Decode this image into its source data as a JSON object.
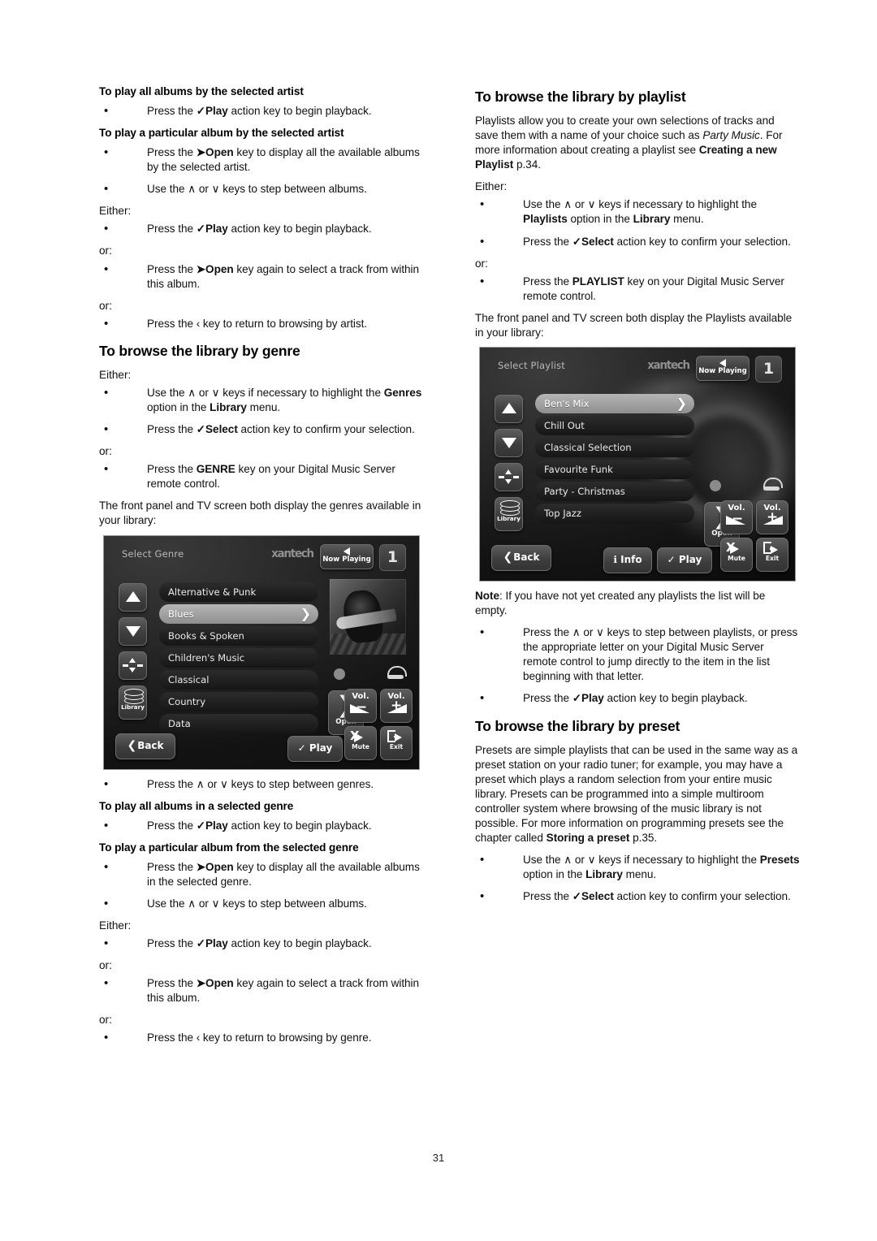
{
  "page": {
    "number": "31"
  },
  "left_column": {
    "blocks": [
      {
        "type": "sub",
        "text": "To play all albums by the selected artist"
      },
      {
        "type": "bullet",
        "html": "Press the <b>✓Play</b> action key to begin playback."
      },
      {
        "type": "sub",
        "text": "To play a particular album by the selected artist"
      },
      {
        "type": "bullet",
        "html": "Press the <b>➤Open</b> key to display all the available albums by the selected artist."
      },
      {
        "type": "bullet",
        "html": "Use the ∧ or ∨ keys to step between albums."
      },
      {
        "type": "lead",
        "text": "Either:"
      },
      {
        "type": "bullet",
        "html": "Press the <b>✓Play</b> action key to begin playback."
      },
      {
        "type": "lead",
        "text": "or:"
      },
      {
        "type": "bullet",
        "html": "Press the <b>➤Open</b> key again to select a track from within this album."
      },
      {
        "type": "lead",
        "text": "or:"
      },
      {
        "type": "bullet",
        "html": "Press the ‹ key to return to browsing by artist."
      },
      {
        "type": "sec",
        "text": "To browse the library by genre"
      },
      {
        "type": "lead",
        "text": "Either:"
      },
      {
        "type": "bullet",
        "html": "Use the ∧ or ∨ keys if necessary to highlight the <b>Genres</b> option in the <b>Library</b> menu."
      },
      {
        "type": "bullet",
        "html": "Press the <b>✓Select</b> action key to confirm your selection."
      },
      {
        "type": "lead",
        "text": "or:"
      },
      {
        "type": "bullet",
        "html": "Press the <b>GENRE</b> key on your Digital Music Server remote control."
      },
      {
        "type": "para",
        "text": "The front panel and TV screen both display the genres available in your library:"
      },
      {
        "type": "shot",
        "id": "genre"
      },
      {
        "type": "bullet",
        "html": "Press the ∧ or ∨ keys to step between genres."
      },
      {
        "type": "sub",
        "text": "To play all albums in a selected genre"
      },
      {
        "type": "bullet",
        "html": "Press the <b>✓Play</b> action key to begin playback."
      },
      {
        "type": "sub",
        "text": "To play a particular album from the selected genre"
      },
      {
        "type": "bullet",
        "html": "Press the <b>➤Open</b> key to display all the available albums in the selected genre."
      },
      {
        "type": "bullet",
        "html": "Use the ∧ or ∨ keys to step between albums."
      },
      {
        "type": "lead",
        "text": "Either:"
      },
      {
        "type": "bullet",
        "html": "Press the <b>✓Play</b> action key to begin playback."
      },
      {
        "type": "lead",
        "text": "or:"
      },
      {
        "type": "bullet",
        "html": "Press the <b>➤Open</b> key again to select a track from within this album."
      },
      {
        "type": "lead",
        "text": "or:"
      },
      {
        "type": "bullet",
        "html": "Press the ‹ key to return to browsing by genre."
      }
    ]
  },
  "right_column": {
    "blocks": [
      {
        "type": "sec",
        "text": "To browse the library by playlist"
      },
      {
        "type": "para",
        "html": "Playlists allow you to create your own selections of tracks and save them with a name of your choice such as <i>Party Music</i>.  For more information about creating a playlist see <b>Creating a new Playlist</b> p.34."
      },
      {
        "type": "lead",
        "text": "Either:"
      },
      {
        "type": "bullet",
        "html": "Use the ∧ or ∨ keys if necessary to highlight the <b>Playlists</b> option in the <b>Library</b> menu."
      },
      {
        "type": "bullet",
        "html": "Press the <b>✓Select</b> action key to confirm your selection."
      },
      {
        "type": "lead",
        "text": "or:"
      },
      {
        "type": "bullet",
        "html": "Press the <b>PLAYLIST</b> key on your Digital Music Server remote control."
      },
      {
        "type": "para",
        "text": "The front panel and TV screen both display the Playlists available in your library:"
      },
      {
        "type": "shot",
        "id": "playlist"
      },
      {
        "type": "para",
        "html": "<b>Note</b>: If you have not yet created any playlists the list will be empty."
      },
      {
        "type": "bullet",
        "html": "Press the ∧ or ∨ keys to step between playlists, or press the appropriate letter on your Digital Music Server remote control to jump directly to the item in the list beginning with that letter."
      },
      {
        "type": "bullet",
        "html": "Press the <b>✓Play</b> action key to begin playback."
      },
      {
        "type": "sec",
        "text": "To browse the library by preset"
      },
      {
        "type": "para",
        "html": "Presets are simple playlists that can be used in the same way as a preset station on your radio tuner; for example, you may have a preset which plays a random selection from your entire music library.  Presets can be programmed into a simple multiroom controller system where browsing of the music library is not possible.  For more information on programming presets see the chapter called <b>Storing a preset</b> p.35."
      },
      {
        "type": "bullet",
        "html": "Use the ∧ or ∨ keys if necessary to highlight the <b>Presets</b> option in the <b>Library</b> menu."
      },
      {
        "type": "bullet",
        "html": "Press the <b>✓Select</b> action key to confirm your selection."
      }
    ]
  },
  "screens": {
    "genre": {
      "title": "Select Genre",
      "brand": "xantech",
      "now_playing_label": "Now Playing",
      "zone": "1",
      "items": [
        {
          "label": "Alternative & Punk",
          "selected": false
        },
        {
          "label": "Blues",
          "selected": true
        },
        {
          "label": "Books & Spoken",
          "selected": false
        },
        {
          "label": "Children's Music",
          "selected": false
        },
        {
          "label": "Classical",
          "selected": false
        },
        {
          "label": "Country",
          "selected": false
        },
        {
          "label": "Data",
          "selected": false
        }
      ],
      "library_label": "Library",
      "back_label": "Back",
      "open_label": "Open",
      "play_label": "Play",
      "info_label": null,
      "vol_down_label": "Vol.",
      "vol_up_label": "Vol.",
      "mute_label": "Mute",
      "exit_label": "Exit"
    },
    "playlist": {
      "title": "Select Playlist",
      "brand": "xantech",
      "now_playing_label": "Now Playing",
      "zone": "1",
      "items": [
        {
          "label": "Ben's Mix",
          "selected": true
        },
        {
          "label": "Chill Out",
          "selected": false
        },
        {
          "label": "Classical Selection",
          "selected": false
        },
        {
          "label": "Favourite Funk",
          "selected": false
        },
        {
          "label": "Party - Christmas",
          "selected": false
        },
        {
          "label": "Top Jazz",
          "selected": false
        }
      ],
      "library_label": "Library",
      "back_label": "Back",
      "open_label": "Open",
      "play_label": "Play",
      "info_label": "Info",
      "vol_down_label": "Vol.",
      "vol_up_label": "Vol.",
      "mute_label": "Mute",
      "exit_label": "Exit"
    }
  }
}
